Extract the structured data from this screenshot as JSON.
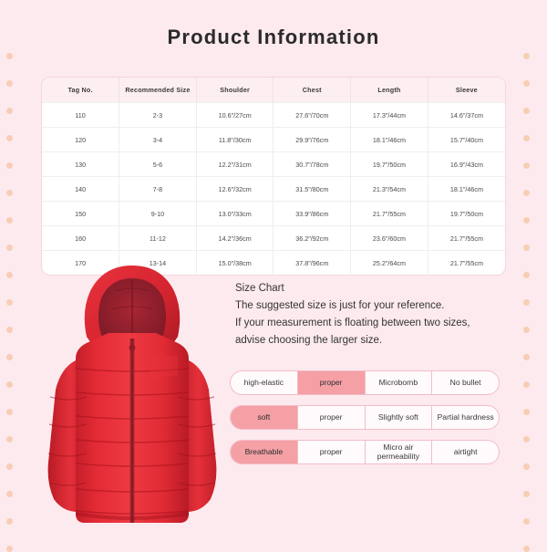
{
  "page": {
    "title": "Product  Information",
    "background_color": "#fdeaee",
    "accent_color": "#f4a0a5",
    "dot_color": "#f6c9aa"
  },
  "size_table": {
    "headers": [
      "Tag No.",
      "Recommended Size",
      "Shoulder",
      "Chest",
      "Length",
      "Sleeve"
    ],
    "rows": [
      [
        "110",
        "2-3",
        "10.6\"/27cm",
        "27.6\"/70cm",
        "17.3\"/44cm",
        "14.6\"/37cm"
      ],
      [
        "120",
        "3-4",
        "11.8\"/30cm",
        "29.9\"/76cm",
        "18.1\"/46cm",
        "15.7\"/40cm"
      ],
      [
        "130",
        "5-6",
        "12.2\"/31cm",
        "30.7\"/78cm",
        "19.7\"/50cm",
        "16.9\"/43cm"
      ],
      [
        "140",
        "7-8",
        "12.6\"/32cm",
        "31.5\"/80cm",
        "21.3\"/54cm",
        "18.1\"/46cm"
      ],
      [
        "150",
        "9-10",
        "13.0\"/33cm",
        "33.9\"/86cm",
        "21.7\"/55cm",
        "19.7\"/50cm"
      ],
      [
        "160",
        "11-12",
        "14.2\"/36cm",
        "36.2\"/92cm",
        "23.6\"/60cm",
        "21.7\"/55cm"
      ],
      [
        "170",
        "13-14",
        "15.0\"/38cm",
        "37.8\"/96cm",
        "25.2\"/64cm",
        "21.7\"/55cm"
      ]
    ]
  },
  "product_image": {
    "name": "red-puffer-jacket",
    "body_color": "#e0232e",
    "shade_color": "#b81b26",
    "hood_lining_color": "#9e2230"
  },
  "size_chart_note": {
    "heading": "Size Chart",
    "line1": "The suggested size is just for your reference.",
    "line2": "If your measurement is floating between two sizes,",
    "line3": "advise choosing the larger size."
  },
  "scales": [
    {
      "name": "elasticity",
      "cells": [
        {
          "label": "high-elastic",
          "active": false
        },
        {
          "label": "proper",
          "active": true
        },
        {
          "label": "Microbomb",
          "active": false
        },
        {
          "label": "No bullet",
          "active": false
        }
      ]
    },
    {
      "name": "softness",
      "cells": [
        {
          "label": "soft",
          "active": true
        },
        {
          "label": "proper",
          "active": false
        },
        {
          "label": "Slightly soft",
          "active": false
        },
        {
          "label": "Partial hardness",
          "active": false
        }
      ]
    },
    {
      "name": "breathability",
      "cells": [
        {
          "label": "Breathable",
          "active": true
        },
        {
          "label": "proper",
          "active": false
        },
        {
          "label": "Micro air permeability",
          "active": false
        },
        {
          "label": "airtight",
          "active": false
        }
      ]
    }
  ]
}
